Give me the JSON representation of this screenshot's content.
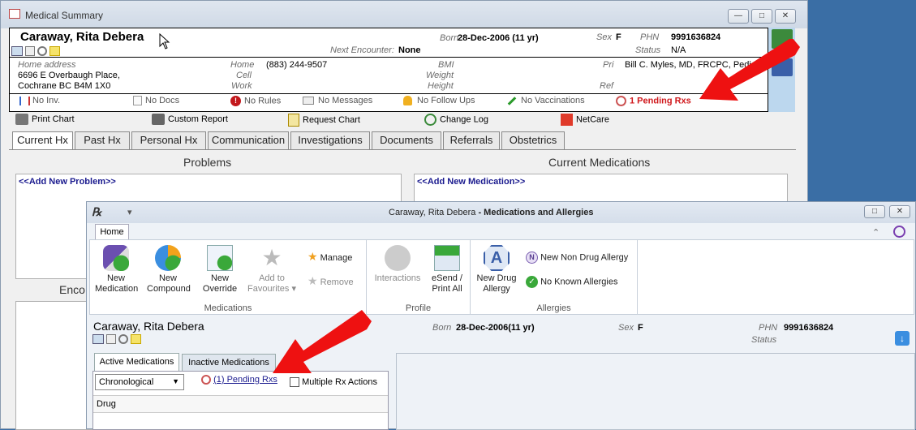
{
  "summary_window": {
    "title": "Medical Summary",
    "patient_name": "Caraway, Rita Debera",
    "born_label": "Born",
    "born_value": "28-Dec-2006 (11 yr)",
    "sex_label": "Sex",
    "sex_value": "F",
    "phn_label": "PHN",
    "phn_value": "9991636824",
    "status_label": "Status",
    "status_value": "N/A",
    "next_encounter_label": "Next Encounter:",
    "next_encounter_value": "None",
    "home_address_label": "Home address",
    "address_line1": "6696 E Overbaugh Place,",
    "address_line2": "Cochrane BC  B4M 1X0",
    "home_label": "Home",
    "home_phone": "(883) 244-9507",
    "cell_label": "Cell",
    "work_label": "Work",
    "bmi_label": "BMI",
    "weight_label": "Weight",
    "height_label": "Height",
    "pri_label": "Pri",
    "pri_value": "Bill C. Myles, MD, FRCPC, Pediat",
    "ref_label": "Ref",
    "status_bar": {
      "no_inv": "No Inv.",
      "no_docs": "No Docs",
      "no_rules": "No Rules",
      "no_messages": "No Messages",
      "no_follow_ups": "No Follow Ups",
      "no_vaccinations": "No Vaccinations",
      "pending_rxs": "1 Pending Rxs"
    },
    "toolbar": {
      "print_chart": "Print Chart",
      "custom_report": "Custom Report",
      "request_chart": "Request Chart",
      "change_log": "Change Log",
      "netcare": "NetCare"
    },
    "tabs": [
      "Current Hx",
      "Past Hx",
      "Personal Hx",
      "Communication",
      "Investigations",
      "Documents",
      "Referrals",
      "Obstetrics"
    ],
    "problems_title": "Problems",
    "add_problem": "<<Add New Problem>>",
    "current_meds_title": "Current Medications",
    "add_medication": "<<Add New Medication>>",
    "encounters_partial": "Enco"
  },
  "rx_window": {
    "title_name": "Caraway, Rita Debera",
    "title_suffix": " - Medications and Allergies",
    "home_tab": "Home",
    "medications_group": "Medications",
    "profile_group": "Profile",
    "allergies_group": "Allergies",
    "buttons": {
      "new_medication": [
        "New",
        "Medication"
      ],
      "new_compound": [
        "New",
        "Compound"
      ],
      "new_override": [
        "New",
        "Override"
      ],
      "add_favourites": [
        "Add to",
        "Favourites ▾"
      ],
      "manage": "Manage",
      "remove": "Remove",
      "interactions": "Interactions",
      "esend": [
        "eSend /",
        "Print All"
      ],
      "new_drug_allergy": [
        "New Drug",
        "Allergy"
      ],
      "new_non_drug_allergy": "New Non Drug Allergy",
      "no_known_allergies": "No Known Allergies"
    },
    "patient_name": "Caraway, Rita Debera",
    "born_label": "Born",
    "born_value": "28-Dec-2006(11 yr)",
    "sex_label": "Sex",
    "sex_value": "F",
    "phn_label": "PHN",
    "phn_value": "9991636824",
    "status_label": "Status",
    "active_tab": "Active Medications",
    "inactive_tab": "Inactive Medications",
    "sort_value": "Chronological",
    "pending_link": "(1) Pending Rxs",
    "multiple_rx": "Multiple Rx Actions",
    "drug_column": "Drug"
  },
  "colors": {
    "desktop": "#3a6ea5",
    "pending_red": "#d0181c",
    "link_blue": "#1b1b8f",
    "arrow_red": "#ee1111"
  }
}
